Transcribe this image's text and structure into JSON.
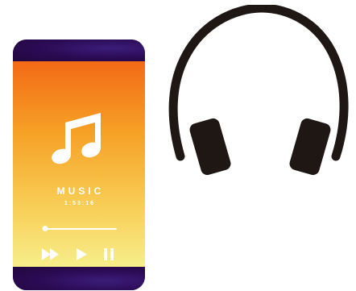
{
  "player": {
    "title": "MUSIC",
    "time": "1:53:16",
    "progress": 0.0
  },
  "icons": {
    "note": "music-note-icon",
    "fast_forward": "fast-forward-icon",
    "play": "play-icon",
    "pause": "pause-icon",
    "headphones": "headphones-icon"
  },
  "colors": {
    "gradient_top": "#f36a16",
    "gradient_bottom": "#f7ee8a",
    "bezel": "#2a0a52",
    "headphones": "#1e1714"
  }
}
